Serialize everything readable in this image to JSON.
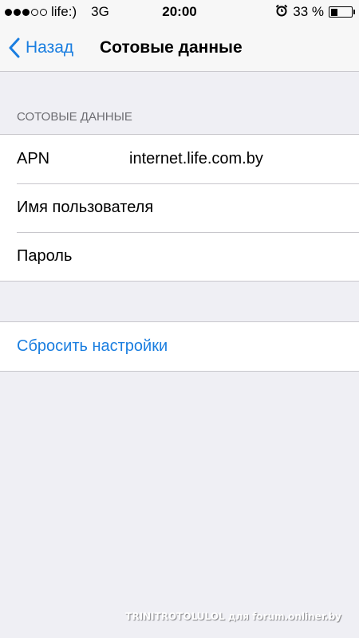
{
  "status_bar": {
    "carrier": "life:)",
    "network": "3G",
    "time": "20:00",
    "battery_percent_label": "33 %",
    "battery_level": 0.33,
    "signal_bars": 3,
    "signal_total": 5
  },
  "nav": {
    "back_label": "Назад",
    "title": "Сотовые данные"
  },
  "section": {
    "header": "СОТОВЫЕ ДАННЫЕ",
    "rows": [
      {
        "label": "APN",
        "value": "internet.life.com.by"
      },
      {
        "label": "Имя пользователя",
        "value": ""
      },
      {
        "label": "Пароль",
        "value": ""
      }
    ]
  },
  "reset": {
    "label": "Сбросить настройки"
  },
  "watermark": "TRINITROTOLULOL для forum.onliner.by",
  "colors": {
    "accent": "#1a7ee0",
    "background": "#efeff4",
    "separator": "#c8c7cc"
  }
}
